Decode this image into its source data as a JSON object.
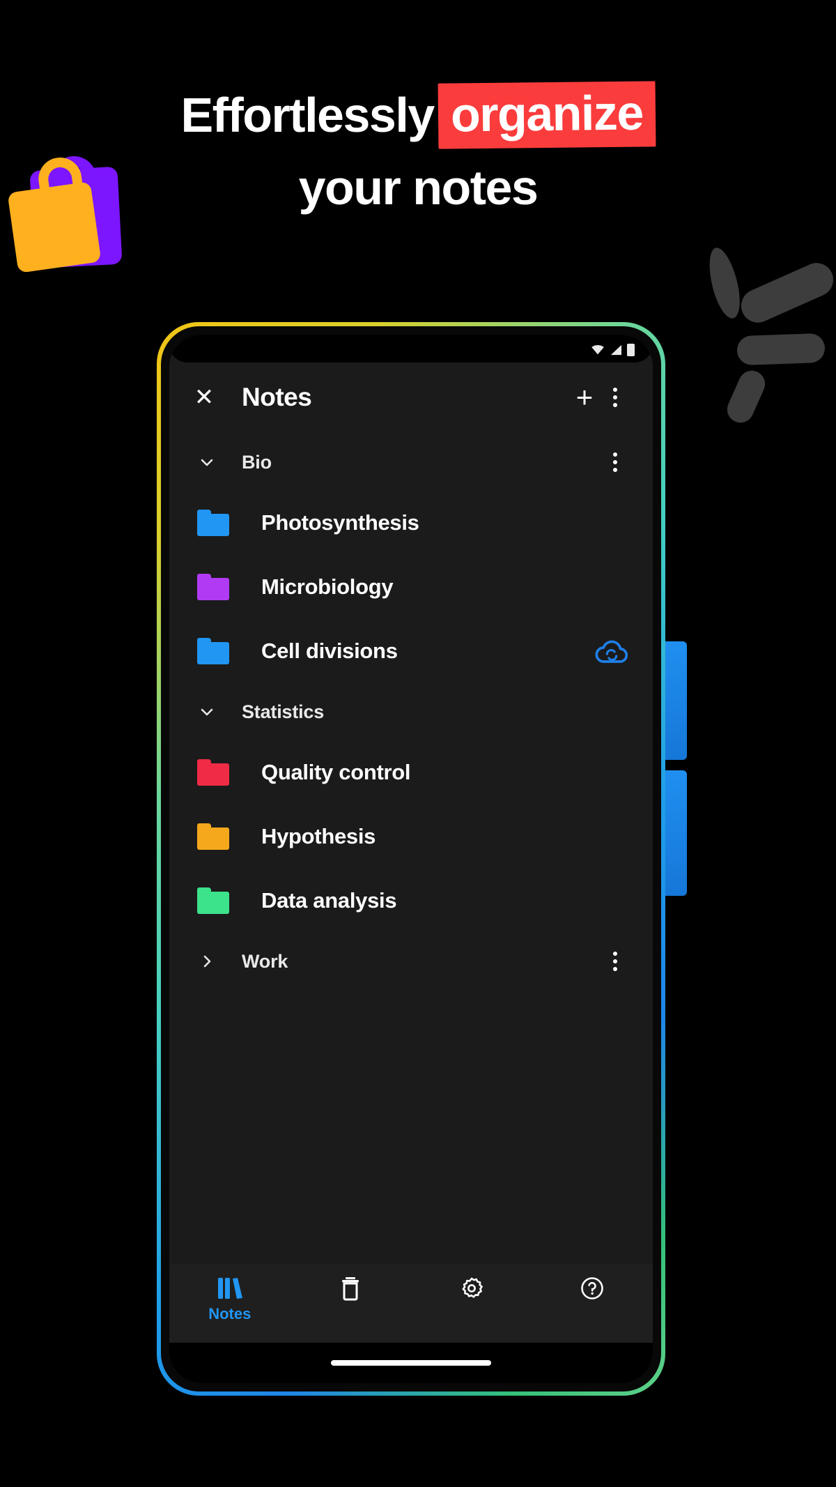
{
  "headline": {
    "line1_plain": "Effortlessly",
    "line1_highlight": "organize",
    "line2": "your notes",
    "highlight_color": "#fa3c3c",
    "text_color": "#ffffff"
  },
  "decorations": {
    "bags": {
      "name": "shopping-bags",
      "front_color": "#ffb01f",
      "back_color": "#7c16ff"
    },
    "burst": {
      "name": "burst-rays",
      "color": "#3d3d3d",
      "ray_count": 4
    },
    "side_tabs": {
      "name": "blue-tabs",
      "color": "#1f8ff0",
      "count": 2
    }
  },
  "phone": {
    "border_gradient": [
      "#f2c515",
      "#46cfc0",
      "#1f86e8",
      "#5fd18a"
    ],
    "screen_bg": "#1b1b1b",
    "status_bar": {
      "icons": [
        "wifi-icon",
        "cellular-signal-icon",
        "battery-icon"
      ]
    },
    "app_bar": {
      "close_label": "✕",
      "title": "Notes",
      "add_label": "+",
      "overflow_label": "more-options"
    },
    "list": [
      {
        "type": "group",
        "label": "Bio",
        "expanded": true,
        "chevron": "chevron-down-icon",
        "has_overflow": true,
        "children": [
          {
            "type": "folder",
            "label": "Photosynthesis",
            "color": "#2196f3",
            "sync": false
          },
          {
            "type": "folder",
            "label": "Microbiology",
            "color": "#b13bf5",
            "sync": false
          },
          {
            "type": "folder",
            "label": "Cell divisions",
            "color": "#2196f3",
            "sync": true,
            "sync_icon": "cloud-sync-icon",
            "sync_color": "#1f7fe8"
          }
        ]
      },
      {
        "type": "group",
        "label": "Statistics",
        "expanded": true,
        "chevron": "chevron-down-icon",
        "has_overflow": false,
        "children": [
          {
            "type": "folder",
            "label": "Quality control",
            "color": "#f02b45",
            "sync": false
          },
          {
            "type": "folder",
            "label": "Hypothesis",
            "color": "#f5a81c",
            "sync": false
          },
          {
            "type": "folder",
            "label": "Data analysis",
            "color": "#3ce38b",
            "sync": false
          }
        ]
      },
      {
        "type": "group",
        "label": "Work",
        "expanded": false,
        "chevron": "chevron-right-icon",
        "has_overflow": true,
        "children": []
      }
    ],
    "bottom_nav": {
      "active_color": "#2196f3",
      "inactive_color": "#ffffff",
      "items": [
        {
          "label": "Notes",
          "icon": "books-icon",
          "active": true
        },
        {
          "label": "",
          "icon": "trash-icon",
          "active": false
        },
        {
          "label": "",
          "icon": "gear-icon",
          "active": false
        },
        {
          "label": "",
          "icon": "help-circle-icon",
          "active": false
        }
      ]
    },
    "gesture_bar": "home-indicator"
  }
}
